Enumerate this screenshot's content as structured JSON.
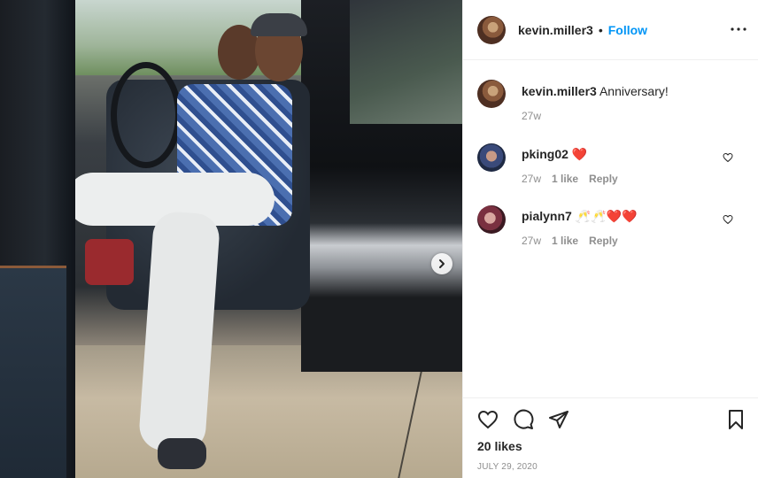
{
  "post": {
    "username": "kevin.miller3",
    "follow_label": "Follow",
    "dot": "•",
    "caption_user": "kevin.miller3",
    "caption_text": "Anniversary!",
    "caption_time": "27w",
    "likes": "20 likes",
    "date": "JULY 29, 2020"
  },
  "comments": [
    {
      "user": "pking02",
      "text": "❤️",
      "time": "27w",
      "likes": "1 like",
      "reply": "Reply"
    },
    {
      "user": "pialynn7",
      "text": "🥂🥂❤️❤️",
      "time": "27w",
      "likes": "1 like",
      "reply": "Reply"
    }
  ],
  "icons": {
    "more": "more-options-icon",
    "like": "heart-icon",
    "comment": "comment-icon",
    "share": "share-icon",
    "save": "bookmark-icon",
    "next": "chevron-right-icon"
  },
  "colors": {
    "accent": "#0095f6",
    "text": "#262626",
    "muted": "#8e8e8e",
    "heart": "#ed1c24"
  }
}
